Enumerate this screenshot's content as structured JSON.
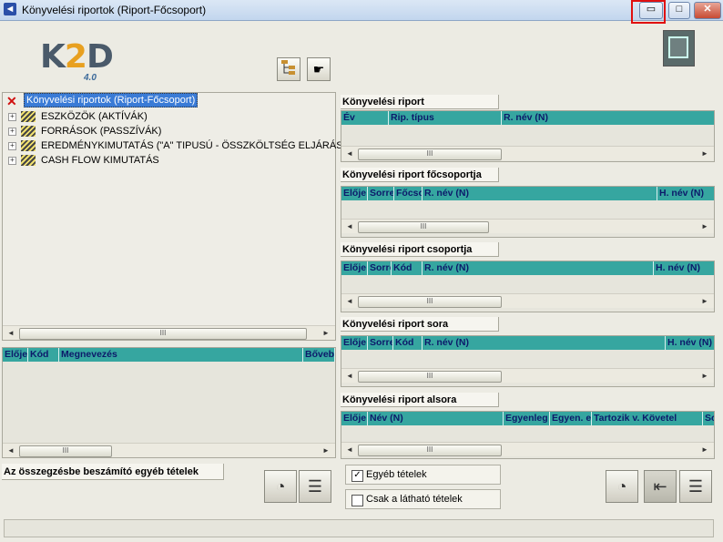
{
  "window": {
    "title": "Könyvelési riportok (Riport-Főcsoport)",
    "minimize_glyph": "▭",
    "maximize_glyph": "□",
    "close_glyph": "✕"
  },
  "logo": {
    "text_k": "K",
    "text_2": "2",
    "text_d": "D",
    "version": "4.0"
  },
  "toolbar": {
    "tree_view_icon": "tree-structure-icon",
    "pointer_icon": "hand-pointer-icon",
    "export_icon": "export-icon"
  },
  "tree": {
    "root_label": "Könyvelési riportok (Riport-Főcsoport)",
    "items": [
      {
        "label": "ESZKÖZÖK (AKTÍVÁK)"
      },
      {
        "label": "FORRÁSOK (PASSZÍVÁK)"
      },
      {
        "label": "EREDMÉNYKIMUTATÁS (\"A\" TIPUSÚ - ÖSSZKÖLTSÉG ELJÁRÁSSA"
      },
      {
        "label": "CASH FLOW KIMUTATÁS"
      }
    ]
  },
  "left_grid": {
    "columns": [
      "Elője",
      "Kód",
      "Megnevezés",
      "Bőveb"
    ]
  },
  "sections": [
    {
      "label": "Könyvelési riport",
      "columns": [
        "Év",
        "Rip. típus",
        "R. név (N)"
      ]
    },
    {
      "label": "Könyvelési riport főcsoportja",
      "columns": [
        "Elője",
        "Sorre",
        "Főcso",
        "R. név (N)",
        "H. név (N)"
      ]
    },
    {
      "label": "Könyvelési riport csoportja",
      "columns": [
        "Elője",
        "Sorre",
        "Kód",
        "R. név (N)",
        "H. név (N)"
      ]
    },
    {
      "label": "Könyvelési riport sora",
      "columns": [
        "Elője",
        "Sorre",
        "Kód",
        "R. név (N)",
        "H. név (N)"
      ]
    },
    {
      "label": "Könyvelési riport alsora",
      "columns": [
        "Elője",
        "Név (N)",
        "Egyenleg",
        "Egyen. e",
        "Tartozik v. Követel",
        "Sc"
      ]
    }
  ],
  "bottom": {
    "summary_label": "Az összegzésbe beszámító egyéb tételek",
    "check_other_items": {
      "label": "Egyéb tételek",
      "checked": true
    },
    "check_visible_items": {
      "label": "Csak a látható tételek",
      "checked": false
    }
  },
  "scroll_thumb_glyph": "III",
  "colors": {
    "grid_header": "#36a6a0",
    "grid_header_text": "#0c1a6a",
    "selection": "#3a7bd6",
    "highlight_box": "#e01010"
  }
}
